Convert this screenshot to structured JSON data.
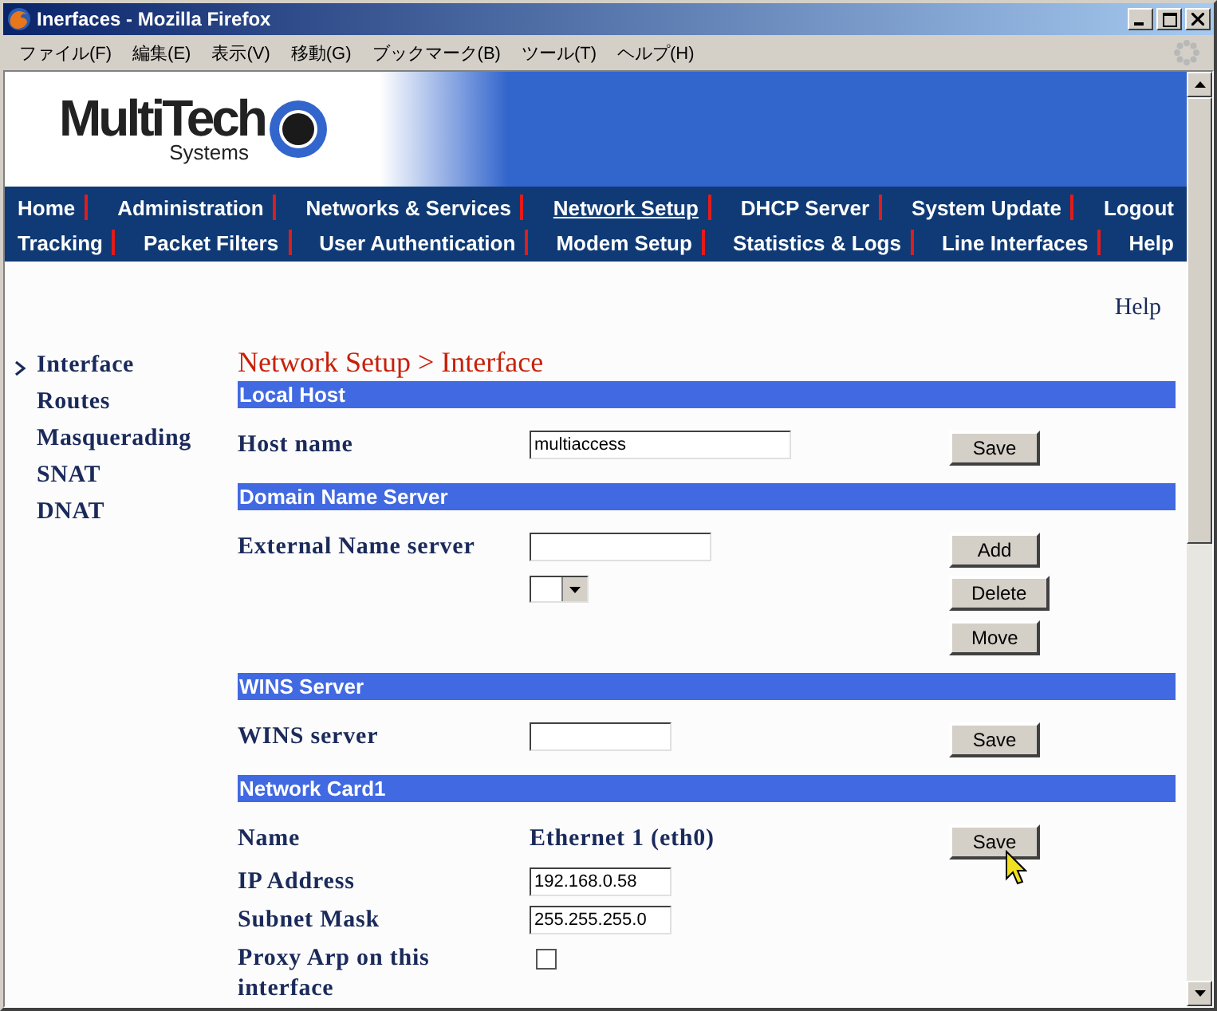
{
  "window": {
    "title": "Inerfaces - Mozilla Firefox"
  },
  "menu": [
    "ファイル(F)",
    "編集(E)",
    "表示(V)",
    "移動(G)",
    "ブックマーク(B)",
    "ツール(T)",
    "ヘルプ(H)"
  ],
  "logo": {
    "name": "MultiTech",
    "sub": "Systems"
  },
  "nav": [
    [
      {
        "label": "Home",
        "selected": false
      },
      {
        "label": "Administration",
        "selected": false
      },
      {
        "label": "Networks & Services",
        "selected": false
      },
      {
        "label": "Network Setup",
        "selected": true
      },
      {
        "label": "DHCP Server",
        "selected": false
      },
      {
        "label": "System Update",
        "selected": false
      },
      {
        "label": "Logout",
        "selected": false
      }
    ],
    [
      {
        "label": "Tracking",
        "selected": false
      },
      {
        "label": "Packet Filters",
        "selected": false
      },
      {
        "label": "User Authentication",
        "selected": false
      },
      {
        "label": "Modem Setup",
        "selected": false
      },
      {
        "label": "Statistics & Logs",
        "selected": false
      },
      {
        "label": "Line Interfaces",
        "selected": false
      },
      {
        "label": "Help",
        "selected": false
      }
    ]
  ],
  "help_link": "Help",
  "sidebar": {
    "items": [
      {
        "label": "Interface",
        "selected": true
      },
      {
        "label": "Routes",
        "selected": false
      },
      {
        "label": "Masquerading",
        "selected": false
      },
      {
        "label": "SNAT",
        "selected": false
      },
      {
        "label": "DNAT",
        "selected": false
      }
    ]
  },
  "breadcrumb": "Network Setup > Interface",
  "sections": [
    {
      "title": "Local Host",
      "rows": [
        {
          "kind": "input",
          "label": "Host name",
          "value": "multiaccess",
          "buttons": [
            "Save"
          ]
        }
      ]
    },
    {
      "title": "Domain Name Server",
      "rows": [
        {
          "kind": "input",
          "label": "External Name server",
          "buttons": [
            "Add"
          ]
        },
        {
          "kind": "select",
          "buttons": [
            "Delete",
            "Move"
          ]
        }
      ]
    },
    {
      "title": "WINS Server",
      "rows": [
        {
          "kind": "input",
          "label": "WINS server",
          "buttons": [
            "Save"
          ]
        }
      ]
    },
    {
      "title": "Network Card1",
      "rows": [
        {
          "kind": "text",
          "label": "Name",
          "value": "Ethernet 1 (eth0)",
          "buttons": [
            "Save"
          ]
        },
        {
          "kind": "input",
          "label": "IP Address",
          "value": "192.168.0.58"
        },
        {
          "kind": "input",
          "label": "Subnet Mask",
          "value": "255.255.255.0"
        },
        {
          "kind": "checkbox",
          "label": "Proxy Arp on this interface",
          "checked": false
        }
      ]
    }
  ]
}
